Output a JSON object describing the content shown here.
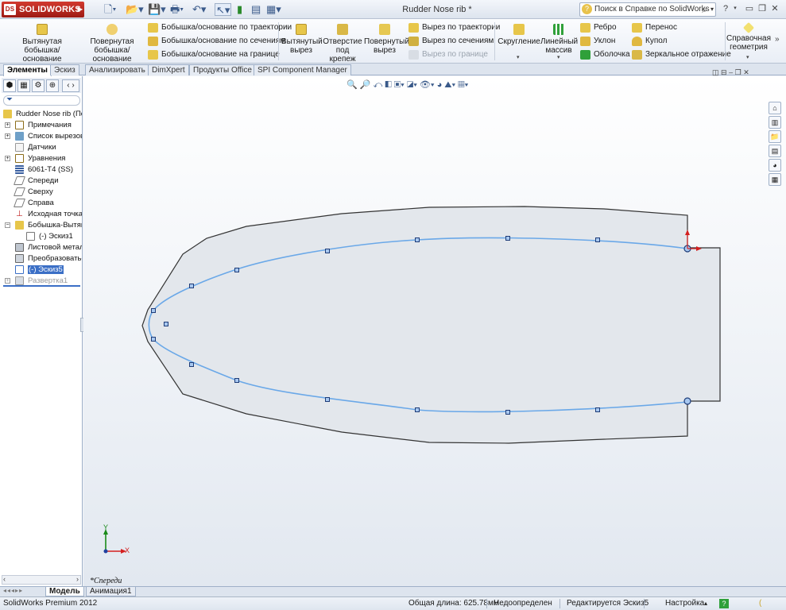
{
  "app": {
    "logo": "SOLIDWORKS",
    "doc_title": "Rudder Nose rib *",
    "help_search_placeholder": "Поиск в Справке по SolidWorks",
    "help_icon": "?"
  },
  "toolbar": {
    "features": {
      "extruded_boss": "Вытянутая бобышка/основание",
      "revolved_boss": "Повернутая бобышка/основание",
      "swept_boss": "Бобышка/основание по траектории",
      "lofted_boss": "Бобышка/основание по сечениям",
      "boundary_boss": "Бобышка/основание на границе",
      "extruded_cut": "Вытянутый вырез",
      "hole_wizard": "Отверстие под крепеж",
      "revolved_cut": "Повернутый вырез",
      "swept_cut": "Вырез по траектории",
      "lofted_cut": "Вырез по сечениям",
      "boundary_cut": "Вырез по границе",
      "fillet": "Скругление",
      "linear_pattern": "Линейный массив",
      "rib": "Ребро",
      "draft": "Уклон",
      "shell": "Оболочка",
      "wrap": "Перенос",
      "dome": "Купол",
      "mirror": "Зеркальное отражение",
      "ref_geometry": "Справочная геометрия"
    }
  },
  "tabs": [
    "Элементы",
    "Эскиз",
    "Анализировать",
    "DimXpert",
    "Продукты Office",
    "SPI Component Manager"
  ],
  "tree": {
    "items": [
      {
        "label": "Rudder Nose rib  (По",
        "icon": "part-icon"
      },
      {
        "label": "Примечания",
        "icon": "annotations-icon"
      },
      {
        "label": "Список вырезов(",
        "icon": "cutlist-icon"
      },
      {
        "label": "Датчики",
        "icon": "sensors-icon"
      },
      {
        "label": "Уравнения",
        "icon": "equations-icon"
      },
      {
        "label": "6061-T4 (SS)",
        "icon": "material-icon"
      },
      {
        "label": "Спереди",
        "icon": "plane-icon"
      },
      {
        "label": "Сверху",
        "icon": "plane-icon"
      },
      {
        "label": "Справа",
        "icon": "plane-icon"
      },
      {
        "label": "Исходная точка",
        "icon": "origin-icon"
      },
      {
        "label": "Бобышка-Вытяну",
        "icon": "boss-extrude-icon"
      },
      {
        "label": "(-) Эскиз1",
        "icon": "sketch-icon"
      },
      {
        "label": "Листовой металл",
        "icon": "sheetmetal-icon"
      },
      {
        "label": "Преобразовать-Т",
        "icon": "convert-icon"
      },
      {
        "label": "(-) Эскиз5",
        "icon": "sketch-icon"
      },
      {
        "label": "Развертка1",
        "icon": "flatpattern-icon"
      }
    ]
  },
  "graphics": {
    "view_name": "*Спереди",
    "triad_y": "Y",
    "triad_x": "X"
  },
  "bottom_tabs": [
    "Модель",
    "Анимация1"
  ],
  "status": {
    "product": "SolidWorks Premium 2012",
    "total_length": "Общая длина: 625.78мм",
    "definition": "Недоопределен",
    "editing": "Редактируется Эскиз5",
    "customize": "Настройка"
  },
  "colors": {
    "spline": "#6aa8e8",
    "plate_fill": "#e3e7ec",
    "plate_edge": "#333333",
    "triad_y": "#1a8a1a",
    "triad_x": "#d42020"
  }
}
